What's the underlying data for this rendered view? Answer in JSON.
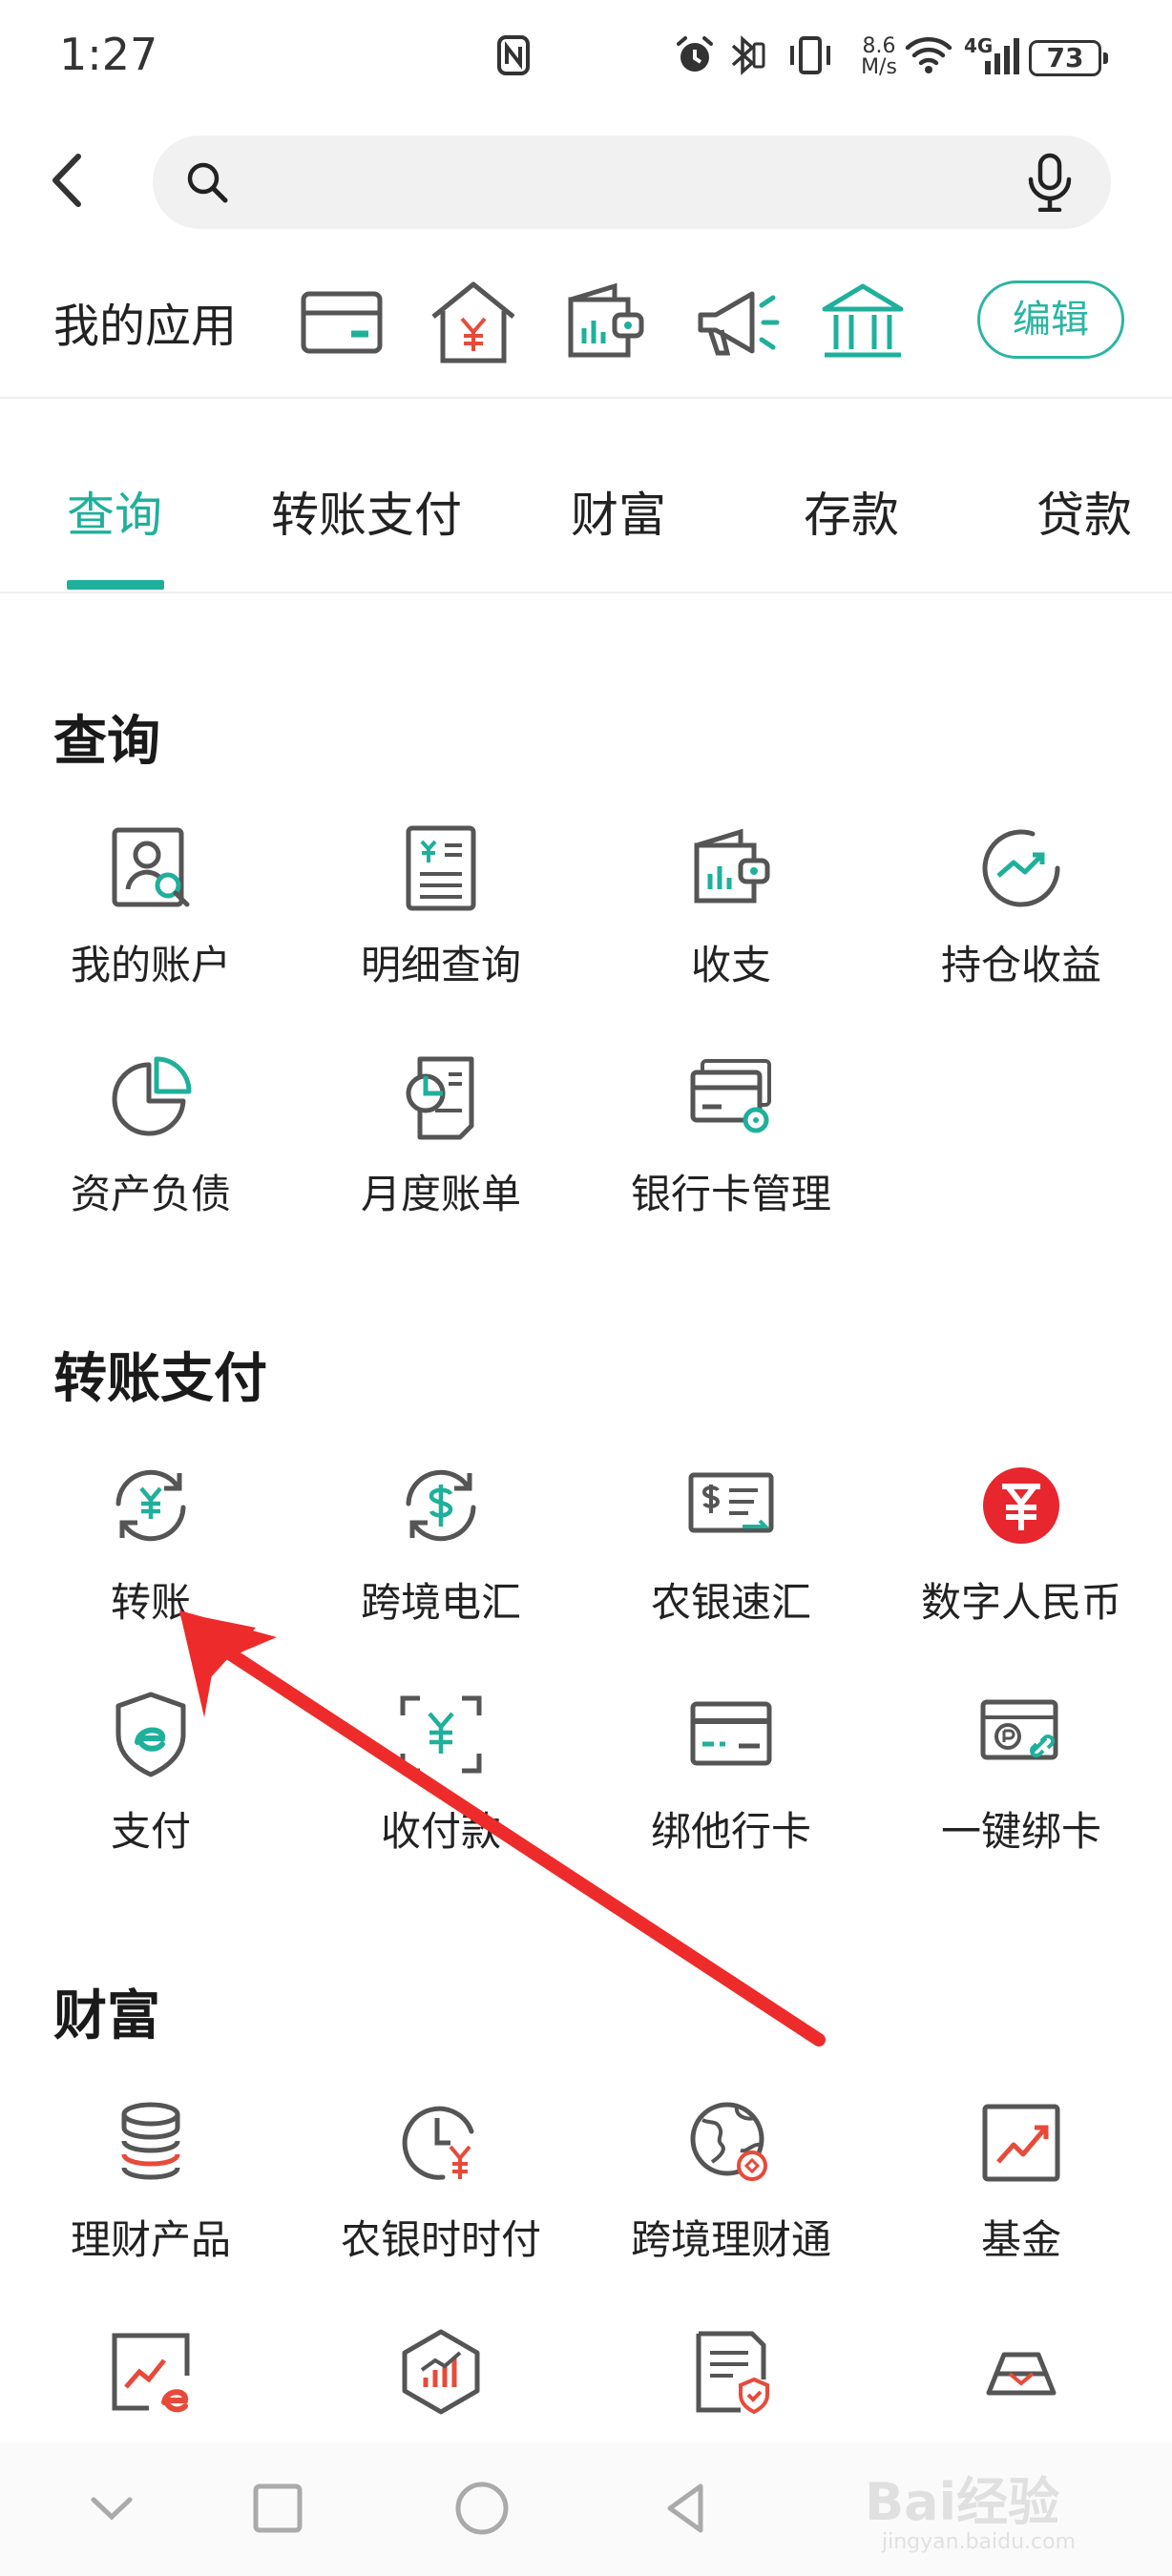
{
  "status_bar": {
    "time": "1:27",
    "speed_value": "8.6",
    "speed_unit": "M/s",
    "network": "4G",
    "battery": "73"
  },
  "search": {
    "placeholder": ""
  },
  "my_apps": {
    "label": "我的应用",
    "icons": [
      "card-icon",
      "house-yuan-icon",
      "wallet-chart-icon",
      "megaphone-icon",
      "bank-icon"
    ],
    "edit_label": "编辑"
  },
  "tabs": [
    {
      "label": "查询",
      "active": true
    },
    {
      "label": "转账支付",
      "active": false
    },
    {
      "label": "财富",
      "active": false
    },
    {
      "label": "存款",
      "active": false
    },
    {
      "label": "贷款",
      "active": false
    }
  ],
  "sections": {
    "query": {
      "title": "查询",
      "items": [
        {
          "label": "我的账户",
          "icon": "account-search-icon"
        },
        {
          "label": "明细查询",
          "icon": "statement-icon"
        },
        {
          "label": "收支",
          "icon": "wallet-chart-icon"
        },
        {
          "label": "持仓收益",
          "icon": "trend-circle-icon"
        },
        {
          "label": "资产负债",
          "icon": "pie-chart-icon"
        },
        {
          "label": "月度账单",
          "icon": "monthly-bill-icon"
        },
        {
          "label": "银行卡管理",
          "icon": "card-settings-icon"
        }
      ]
    },
    "transfer": {
      "title": "转账支付",
      "items": [
        {
          "label": "转账",
          "icon": "yuan-refresh-icon"
        },
        {
          "label": "跨境电汇",
          "icon": "dollar-refresh-icon"
        },
        {
          "label": "农银速汇",
          "icon": "dollar-bill-icon"
        },
        {
          "label": "数字人民币",
          "icon": "digital-rmb-icon"
        },
        {
          "label": "支付",
          "icon": "e-pay-shield-icon"
        },
        {
          "label": "收付款",
          "icon": "scan-yuan-icon"
        },
        {
          "label": "绑他行卡",
          "icon": "card-icon"
        },
        {
          "label": "一键绑卡",
          "icon": "card-link-icon"
        }
      ]
    },
    "wealth": {
      "title": "财富",
      "items": [
        {
          "label": "理财产品",
          "icon": "coin-stack-icon"
        },
        {
          "label": "农银时时付",
          "icon": "clock-yuan-icon"
        },
        {
          "label": "跨境理财通",
          "icon": "globe-icon"
        },
        {
          "label": "基金",
          "icon": "fund-chart-icon"
        },
        {
          "label": "",
          "icon": "e-chart-icon"
        },
        {
          "label": "",
          "icon": "hexagon-chart-icon"
        },
        {
          "label": "",
          "icon": "document-shield-icon"
        },
        {
          "label": "",
          "icon": "gold-bar-icon"
        }
      ]
    }
  },
  "colors": {
    "accent": "#1fb09c",
    "red": "#e83a3a",
    "icon_gray": "#555555"
  },
  "watermark": {
    "text": "Bai经验",
    "url_text": "jingyan.baidu.com"
  }
}
